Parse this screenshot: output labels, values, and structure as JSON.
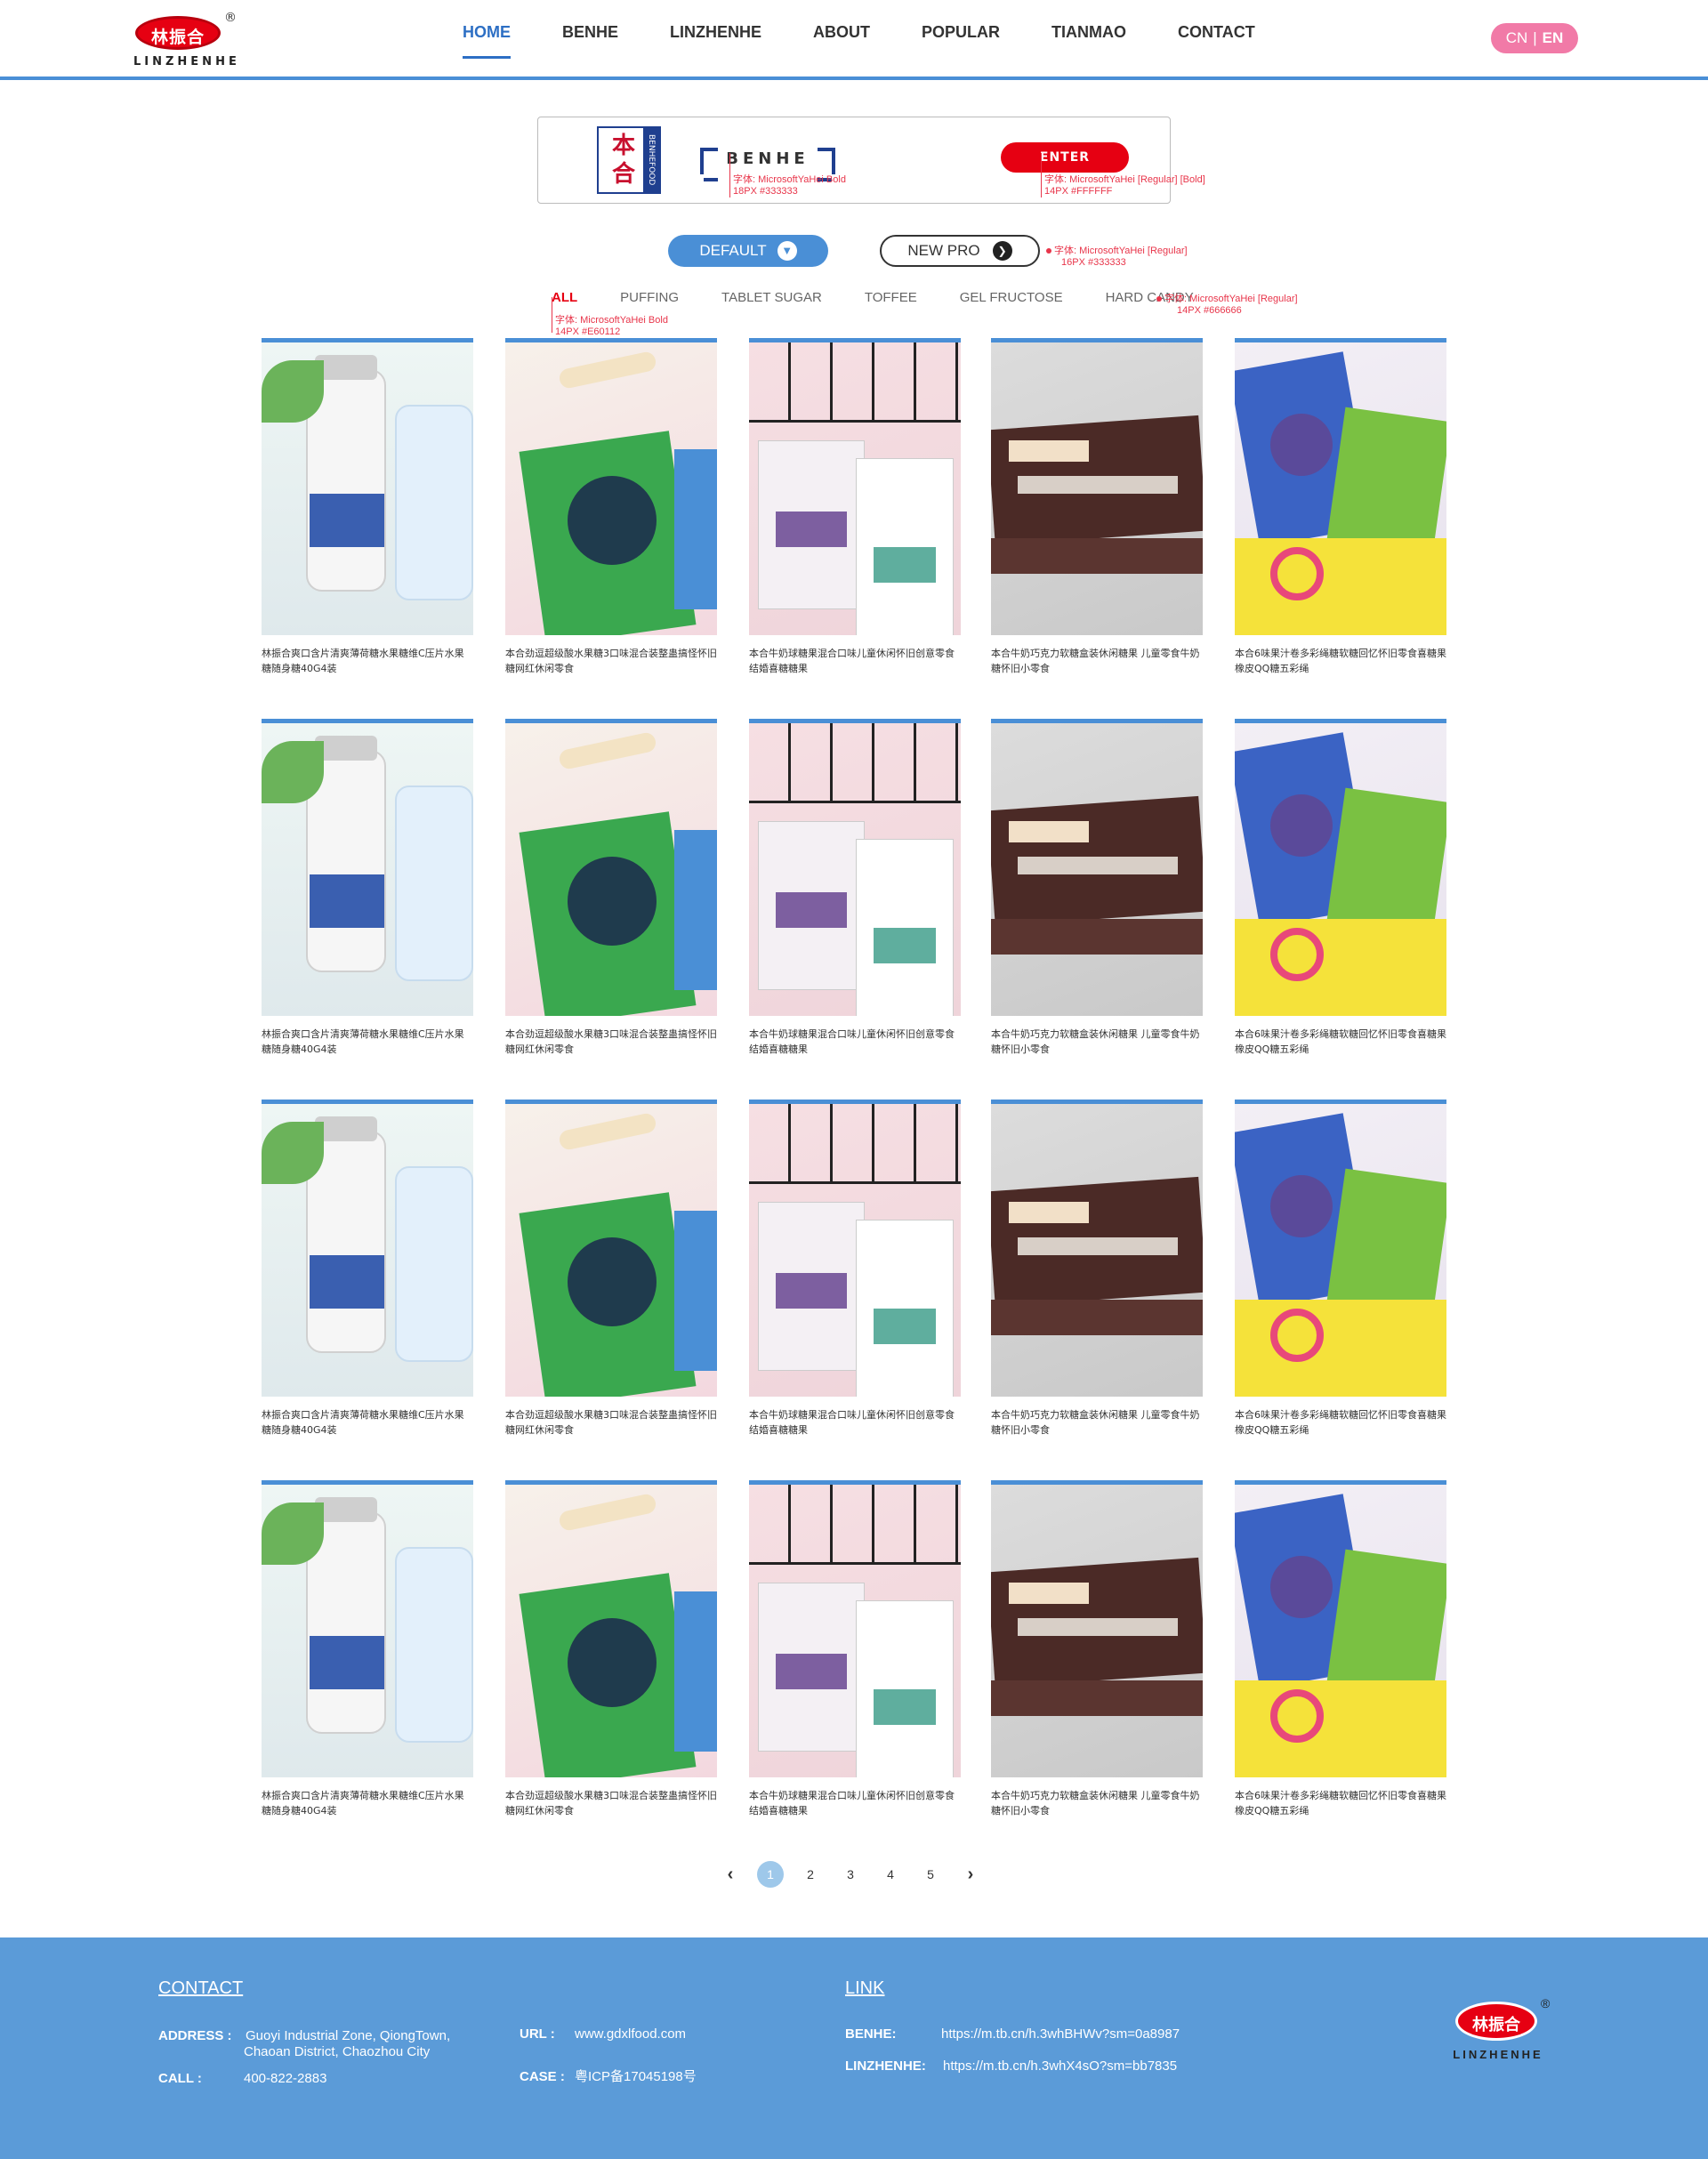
{
  "header": {
    "logo_cn": "林振合",
    "logo_reg": "®",
    "logo_en": "LINZHENHE",
    "nav": [
      "HOME",
      "BENHE",
      "LINZHENHE",
      "ABOUT",
      "POPULAR",
      "TIANMAO",
      "CONTACT"
    ],
    "lang_cn": "CN",
    "lang_sep": "|",
    "lang_en": "EN"
  },
  "brandbar": {
    "badge_cn": "本合",
    "badge_side": "BENHEFOOD",
    "title": "BENHE",
    "enter": "ENTER",
    "note1_line1": "字体: MicrosoftYaHei Bold",
    "note1_line2": "18PX #333333",
    "note2_line1": "字体: MicrosoftYaHei [Regular] [Bold]",
    "note2_line2": "14PX #FFFFFF"
  },
  "filter": {
    "default": "DEFAULT",
    "new_pro": "NEW PRO",
    "note3_line1": "字体: MicrosoftYaHei [Regular]",
    "note3_line2": "16PX #333333",
    "categories": [
      "ALL",
      "PUFFING",
      "TABLET SUGAR",
      "TOFFEE",
      "GEL FRUCTOSE",
      "HARD CANDY"
    ],
    "note4_line1": "字体: MicrosoftYaHei Bold",
    "note4_line2": "14PX #E60112",
    "note5_line1": "字体: MicrosoftYaHei [Regular]",
    "note5_line2": "14PX #666666"
  },
  "products": [
    [
      "林振合爽口含片清爽薄荷糖水果糖维C压片水果糖随身糖40G4装",
      "本合劲逗超级酸水果糖3口味混合装整蛊搞怪怀旧糖网红休闲零食",
      "本合牛奶球糖果混合口味儿童休闲怀旧创意零食结婚喜糖糖果",
      "本合牛奶巧克力软糖盒装休闲糖果 儿童零食牛奶糖怀旧小零食",
      "本合6味果汁卷多彩绳糖软糖回忆怀旧零食喜糖果橡皮QQ糖五彩绳"
    ],
    [
      "林振合爽口含片清爽薄荷糖水果糖维C压片水果糖随身糖40G4装",
      "本合劲逗超级酸水果糖3口味混合装整蛊搞怪怀旧糖网红休闲零食",
      "本合牛奶球糖果混合口味儿童休闲怀旧创意零食结婚喜糖糖果",
      "本合牛奶巧克力软糖盒装休闲糖果 儿童零食牛奶糖怀旧小零食",
      "本合6味果汁卷多彩绳糖软糖回忆怀旧零食喜糖果橡皮QQ糖五彩绳"
    ],
    [
      "林振合爽口含片清爽薄荷糖水果糖维C压片水果糖随身糖40G4装",
      "本合劲逗超级酸水果糖3口味混合装整蛊搞怪怀旧糖网红休闲零食",
      "本合牛奶球糖果混合口味儿童休闲怀旧创意零食结婚喜糖糖果",
      "本合牛奶巧克力软糖盒装休闲糖果 儿童零食牛奶糖怀旧小零食",
      "本合6味果汁卷多彩绳糖软糖回忆怀旧零食喜糖果橡皮QQ糖五彩绳"
    ],
    [
      "林振合爽口含片清爽薄荷糖水果糖维C压片水果糖随身糖40G4装",
      "本合劲逗超级酸水果糖3口味混合装整蛊搞怪怀旧糖网红休闲零食",
      "本合牛奶球糖果混合口味儿童休闲怀旧创意零食结婚喜糖糖果",
      "本合牛奶巧克力软糖盒装休闲糖果 儿童零食牛奶糖怀旧小零食",
      "本合6味果汁卷多彩绳糖软糖回忆怀旧零食喜糖果橡皮QQ糖五彩绳"
    ]
  ],
  "pager": {
    "pages": [
      "1",
      "2",
      "3",
      "4",
      "5"
    ],
    "current": "1",
    "prev": "‹",
    "next": "›"
  },
  "footer": {
    "contact_title": "CONTACT",
    "address_label": "ADDRESS :",
    "address_line1": "Guoyi Industrial Zone, QiongTown,",
    "address_line2": "Chaoan District, Chaozhou City",
    "call_label": "CALL :",
    "call_value": "400-822-2883",
    "url_label": "URL  :",
    "url_value": "www.gdxlfood.com",
    "case_label": "CASE :",
    "case_value": "粤ICP备17045198号",
    "link_title": "LINK",
    "benhe_label": "BENHE:",
    "benhe_value": "https://m.tb.cn/h.3whBHWv?sm=0a8987",
    "linzhenhe_label": "LINZHENHE:",
    "linzhenhe_value": "https://m.tb.cn/h.3whX4sO?sm=bb7835",
    "logo_cn": "林振合",
    "logo_reg": "®",
    "logo_en": "LINZHENHE"
  }
}
